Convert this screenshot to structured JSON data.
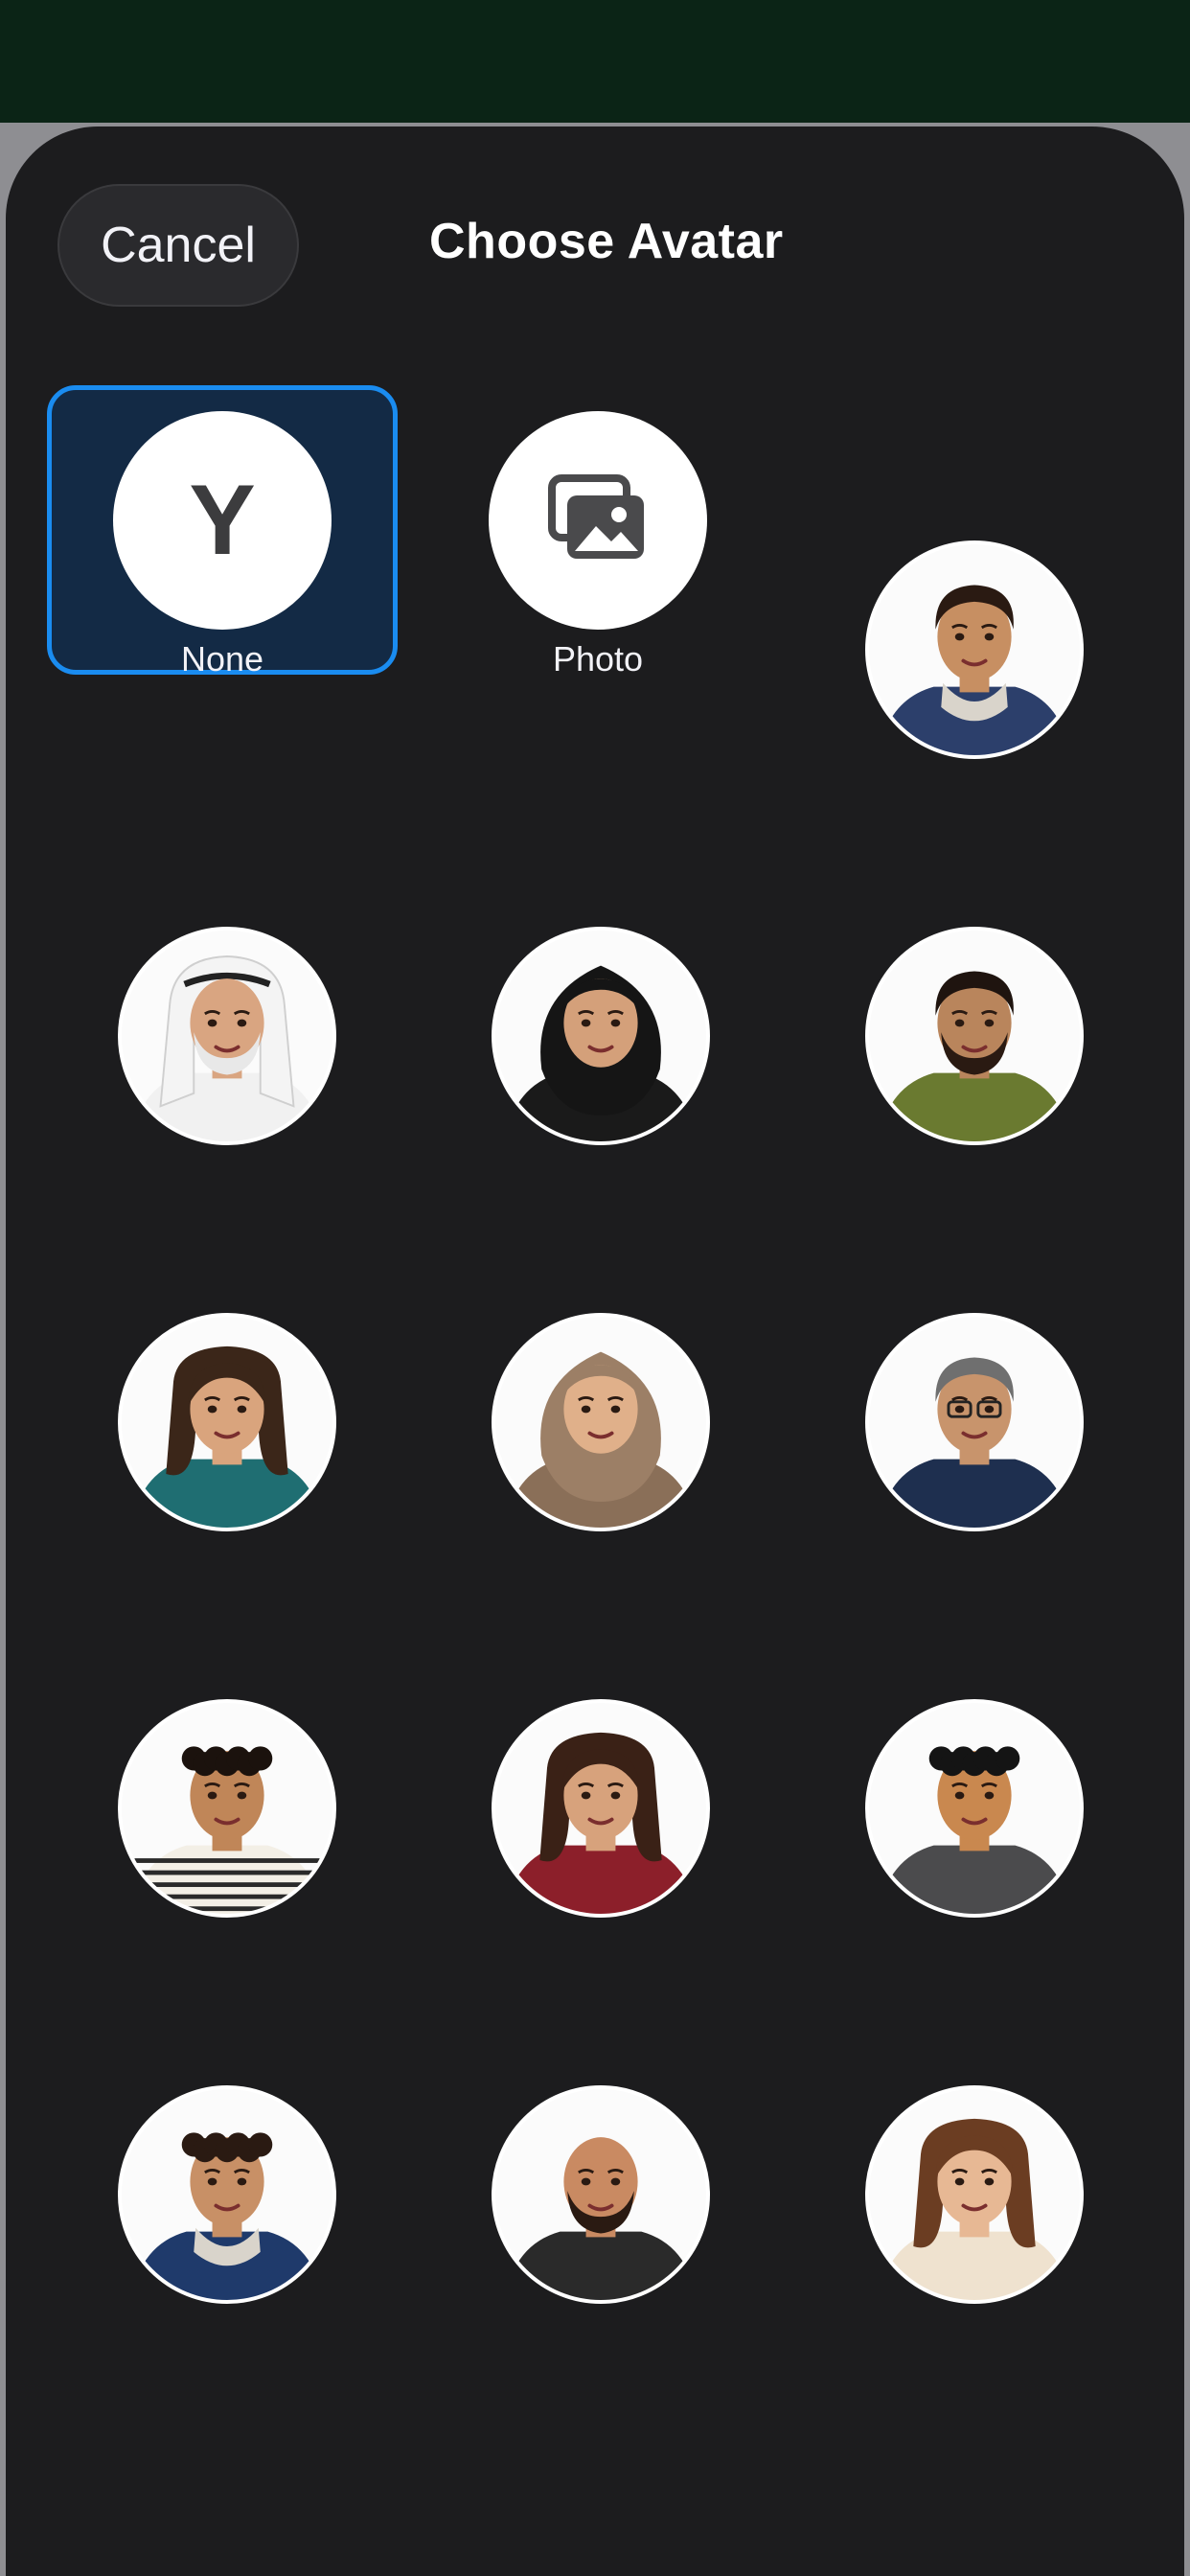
{
  "sheet": {
    "cancel_label": "Cancel",
    "title": "Choose Avatar"
  },
  "options": [
    {
      "label": "None",
      "initial": "Y",
      "kind": "initial",
      "selected": true
    },
    {
      "label": "Photo",
      "kind": "photo",
      "icon": "photo-library-icon",
      "selected": false
    }
  ],
  "avatars": [
    {
      "skin": "#c78f62",
      "hair": "#2a1a12",
      "shirt": "#2c3f6b",
      "hairStyle": "short",
      "accent": "hoodie"
    },
    {
      "skin": "#d9a581",
      "hair": "#ffffff",
      "shirt": "#f1f1f1",
      "hairStyle": "ghutra",
      "accent": "beard-white"
    },
    {
      "skin": "#d4a07a",
      "hair": "#151515",
      "shirt": "#1a1a1a",
      "hairStyle": "hijab",
      "accent": "none"
    },
    {
      "skin": "#b9855c",
      "hair": "#1f140f",
      "shirt": "#6a7a30",
      "hairStyle": "short",
      "accent": "beard"
    },
    {
      "skin": "#d9a47d",
      "hair": "#3b2619",
      "shirt": "#1f6e72",
      "hairStyle": "curly-long",
      "accent": "none"
    },
    {
      "skin": "#e0b08a",
      "hair": "#9c7f66",
      "shirt": "#8a6f58",
      "hairStyle": "hijab",
      "accent": "none"
    },
    {
      "skin": "#c8946c",
      "hair": "#6f6f6f",
      "shirt": "#1e2f4f",
      "hairStyle": "short-gray",
      "accent": "glasses"
    },
    {
      "skin": "#c08658",
      "hair": "#1b120d",
      "shirt": "#f3efe6",
      "hairStyle": "curly",
      "accent": "stripes"
    },
    {
      "skin": "#d7a27c",
      "hair": "#3a2116",
      "shirt": "#8c1f2a",
      "hairStyle": "long",
      "accent": "none"
    },
    {
      "skin": "#c9884f",
      "hair": "#141414",
      "shirt": "#4b4b4d",
      "hairStyle": "curly",
      "accent": "none"
    },
    {
      "skin": "#c89066",
      "hair": "#2a1a12",
      "shirt": "#1f3a6b",
      "hairStyle": "curly",
      "accent": "hoodie"
    },
    {
      "skin": "#c98a62",
      "hair": "#c98a62",
      "shirt": "#2a2a2a",
      "hairStyle": "bald",
      "accent": "beard"
    },
    {
      "skin": "#e7b894",
      "hair": "#6b3d22",
      "shirt": "#efe2cf",
      "hairStyle": "long-wavy",
      "accent": "none"
    }
  ]
}
